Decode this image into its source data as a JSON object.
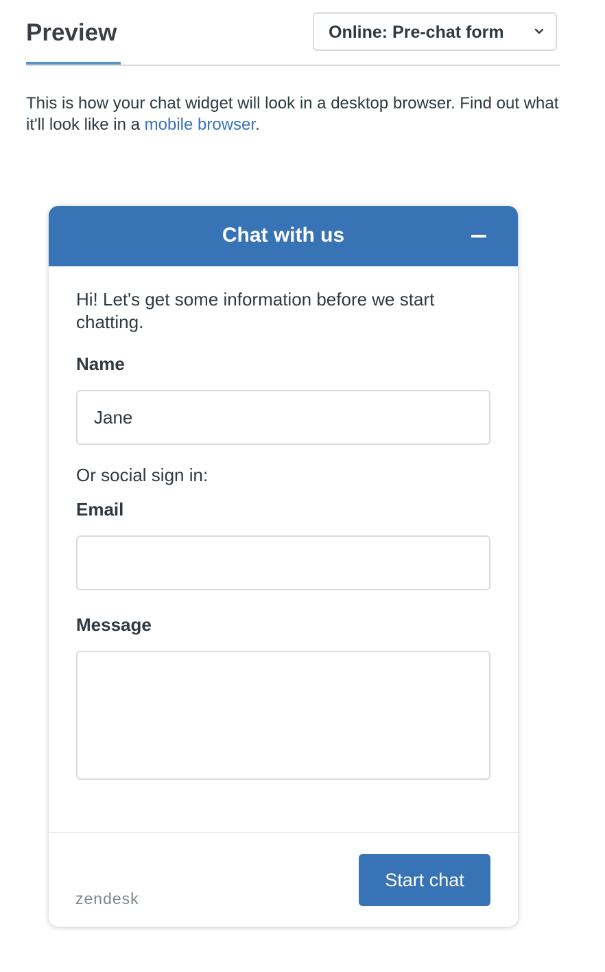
{
  "header": {
    "tab_label": "Preview",
    "mode_select": {
      "selected": "Online: Pre-chat form"
    }
  },
  "description": {
    "text_before_link": "This is how your chat widget will look in a desktop browser. Find out what it'll look like in a ",
    "link_text": "mobile browser",
    "text_after_link": "."
  },
  "widget": {
    "title": "Chat with us",
    "greeting": "Hi! Let's get some information before we start chatting.",
    "name_label": "Name",
    "name_value": "Jane",
    "social_text": "Or social sign in:",
    "email_label": "Email",
    "email_value": "",
    "message_label": "Message",
    "message_value": "",
    "start_button": "Start chat",
    "brand": "zendesk"
  },
  "colors": {
    "accent": "#3873b5",
    "tab_underline": "#5b8fc5",
    "text": "#2f3941",
    "border": "#d8dcde",
    "brand_text": "#7e868c"
  },
  "icons": {
    "select": "chevron-down-icon",
    "minimize": "minimize-icon"
  }
}
